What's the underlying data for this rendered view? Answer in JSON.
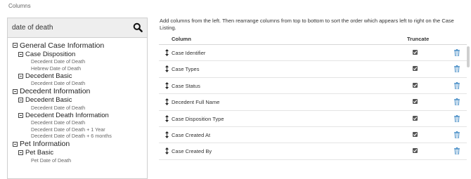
{
  "section_title": "Columns",
  "search": {
    "value": "date of death"
  },
  "tree": {
    "general": {
      "label": "General Case Information",
      "case_disposition": {
        "label": "Case Disposition",
        "leaves": [
          "Decedent Date of Death",
          "Hebrew Date of Death"
        ]
      },
      "decedent_basic": {
        "label": "Decedent Basic",
        "leaves": [
          "Decedent Date of Death"
        ]
      }
    },
    "decedent": {
      "label": "Decedent Information",
      "decedent_basic": {
        "label": "Decedent Basic",
        "leaves": [
          "Decedent Date of Death"
        ]
      },
      "death_info": {
        "label": "Decedent Death Information",
        "leaves": [
          "Decedent Date of Death",
          "Decedent Date of Death + 1 Year",
          "Decedent Date of Death + 6 months"
        ]
      }
    },
    "pet": {
      "label": "Pet Information",
      "pet_basic": {
        "label": "Pet Basic",
        "leaves": [
          "Pet Date of Death"
        ]
      }
    }
  },
  "instructions": "Add columns from the left. Then rearrange columns from top to bottom to sort the order which appears left to right on the Case Listing.",
  "table": {
    "header_column": "Column",
    "header_truncate": "Truncate",
    "rows": [
      {
        "label": "Case Identifier",
        "truncate": true
      },
      {
        "label": "Case Types",
        "truncate": true
      },
      {
        "label": "Case Status",
        "truncate": true
      },
      {
        "label": "Decedent Full Name",
        "truncate": true
      },
      {
        "label": "Case Disposition Type",
        "truncate": true
      },
      {
        "label": "Case Created At",
        "truncate": true
      },
      {
        "label": "Case Created By",
        "truncate": true
      }
    ]
  },
  "colors": {
    "trash": "#4a8fc7",
    "checkbox": "#555555",
    "panel_border": "#cfcfcf"
  },
  "icons": [
    "search-icon",
    "minus-square-icon",
    "drag-handle-icon",
    "checkbox-checked-icon",
    "trash-icon"
  ]
}
